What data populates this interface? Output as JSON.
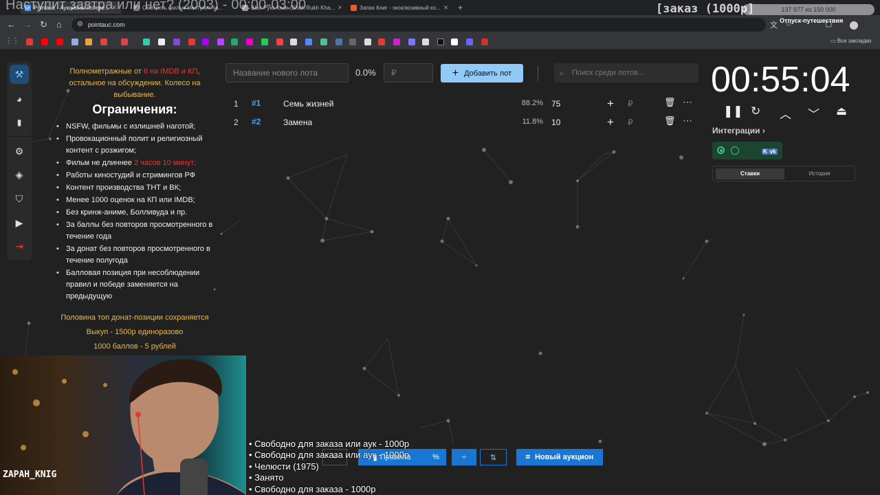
{
  "browser": {
    "tabs": [
      {
        "title": "Pointauc - Аукционы лотере...",
        "active": true
      },
      {
        "title": "Смотреть фильм Наступит за..."
      },
      {
        "title": "Шах Рукх Кхан (Shah Rukh Kha..."
      },
      {
        "title": "Запах Книг - эксклюзивный ко..."
      }
    ],
    "url": "pointauc.com",
    "all_bookmarks": "Все закладки",
    "profile_label": "Отпуск-путешествия"
  },
  "overlay": {
    "title": "Наступит завтра или нет? (2003) - 00:00-03:00",
    "order_tag": "[заказ (1000р]",
    "progress_text": "137 977 из 150 000",
    "progress_fraction": 0.92,
    "streamer": "ZAPAH_KNIG",
    "order_list": [
      "• Свободно для заказа или аук - 1000р",
      "• Свободно для заказа или аук - 1000р",
      "• Челюсти (1975)",
      "• Занято",
      "• Свободно для заказа - 1000р"
    ]
  },
  "rules": {
    "intro_a": "Полнометражные от ",
    "intro_b": "6 на IMDB и КП",
    "intro_c": ", остальное на обсуждении. Колесо на выбывание.",
    "heading": "Ограничения:",
    "items": [
      "NSFW, фильмы с излишней наготой;",
      "Провокационный полит и религиозный контент с розжигом;",
      "Фильм не длиннее ",
      "Работы киностудий и стримингов РФ",
      "Контент производства ТНТ и ВК;",
      "Менее 1000 оценок на КП или IMDB;",
      "Без кринж-аниме, Болливуда и пр.",
      "За баллы без повторов просмотренного в течение года",
      "За донат без повторов просмотренного в течение полугода",
      "Балловая позиция при несоблюдении правил и победе заменяется на предыдущую"
    ],
    "duration_limit": "2 часов 10 минут;",
    "note1": "Половина топ донат-позиции сохраняется",
    "note2": "Выкуп - 1500р единоразово",
    "note3": "1000 баллов - 5 рублей"
  },
  "lot_form": {
    "name_placeholder": "Название нового лота",
    "percent": "0.0%",
    "amount_placeholder": "₽",
    "add_label": "Добавить лот",
    "search_placeholder": "Поиск среди лотов..."
  },
  "lots": [
    {
      "index": "1",
      "tag": "#1",
      "name": "Семь жизней",
      "percent": "88.2%",
      "amount": "75",
      "currency": "₽"
    },
    {
      "index": "2",
      "tag": "#2",
      "name": "Замена",
      "percent": "11.8%",
      "amount": "10",
      "currency": "₽"
    }
  ],
  "timer": {
    "value": "00:55:04",
    "integrations_label": "Интеграции",
    "vk_label": "K",
    "vk_badge": "vk",
    "tabs": [
      "Ставки",
      "История"
    ]
  },
  "toolbar": {
    "rules_label": "Правила",
    "pct_label": "%",
    "new_auction": "Новый аукцион"
  },
  "icons": [
    "chevron-down-icon",
    "close-icon",
    "plus-icon",
    "back-icon",
    "forward-icon",
    "reload-icon",
    "home-icon",
    "tune-icon",
    "translate-icon",
    "star-icon",
    "extension-icon",
    "apps-icon",
    "folder-icon",
    "gavel-icon",
    "pie-chart-icon",
    "bar-chart-icon",
    "gear-icon",
    "layers-icon",
    "shield-icon",
    "video-library-icon",
    "logout-icon",
    "search-icon",
    "trash-icon",
    "more-icon",
    "pause-icon",
    "restart-icon",
    "chevron-up-icon",
    "eject-icon",
    "crosshair-icon"
  ],
  "colors": {
    "accent": "#90caf9",
    "primary_button": "#1976d2",
    "highlight_yellow": "#e9b949",
    "highlight_red": "#e53935",
    "integration_green": "#3ec27a"
  }
}
